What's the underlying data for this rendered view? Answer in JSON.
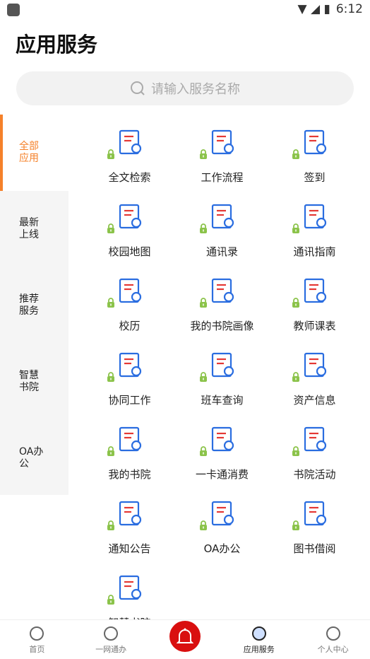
{
  "status": {
    "time": "6:12"
  },
  "header": {
    "title": "应用服务"
  },
  "search": {
    "placeholder": "请输入服务名称"
  },
  "sidebar": {
    "items": [
      {
        "label": "全部\n应用",
        "active": true
      },
      {
        "label": "最新\n上线"
      },
      {
        "label": "推荐\n服务"
      },
      {
        "label": "智慧\n书院"
      },
      {
        "label": "OA办\n公"
      }
    ]
  },
  "services": [
    {
      "label": "全文检索",
      "icon": "document-search-icon"
    },
    {
      "label": "工作流程",
      "icon": "workflow-icon"
    },
    {
      "label": "签到",
      "icon": "location-pin-icon"
    },
    {
      "label": "校园地图",
      "icon": "globe-map-icon"
    },
    {
      "label": "通讯录",
      "icon": "contacts-icon"
    },
    {
      "label": "通讯指南",
      "icon": "phone-icon"
    },
    {
      "label": "校历",
      "icon": "calendar-clock-icon"
    },
    {
      "label": "我的书院画像",
      "icon": "monitor-chart-icon"
    },
    {
      "label": "教师课表",
      "icon": "schedule-bell-icon"
    },
    {
      "label": "协同工作",
      "icon": "collaboration-icon"
    },
    {
      "label": "班车查询",
      "icon": "bus-icon"
    },
    {
      "label": "资产信息",
      "icon": "assets-icon"
    },
    {
      "label": "我的书院",
      "icon": "building-icon"
    },
    {
      "label": "一卡通消费",
      "icon": "card-machine-icon"
    },
    {
      "label": "书院活动",
      "icon": "activity-icon"
    },
    {
      "label": "通知公告",
      "icon": "megaphone-icon"
    },
    {
      "label": "OA办公",
      "icon": "envelope-icon"
    },
    {
      "label": "图书借阅",
      "icon": "book-icon"
    },
    {
      "label": "智慧书院",
      "icon": "trophy-icon"
    }
  ],
  "nav": {
    "items": [
      {
        "label": "首页",
        "icon": "home-icon"
      },
      {
        "label": "一网通办",
        "icon": "hexagon-y-icon"
      },
      {
        "label": "",
        "icon": "bell-icon"
      },
      {
        "label": "应用服务",
        "icon": "app-services-icon",
        "active": true
      },
      {
        "label": "个人中心",
        "icon": "person-icon"
      }
    ]
  },
  "colors": {
    "accent": "#f5812a",
    "icon_blue": "#2a6de0",
    "icon_red": "#e53935",
    "lock_green": "#8bc34a",
    "bell_red": "#d90f0f"
  }
}
